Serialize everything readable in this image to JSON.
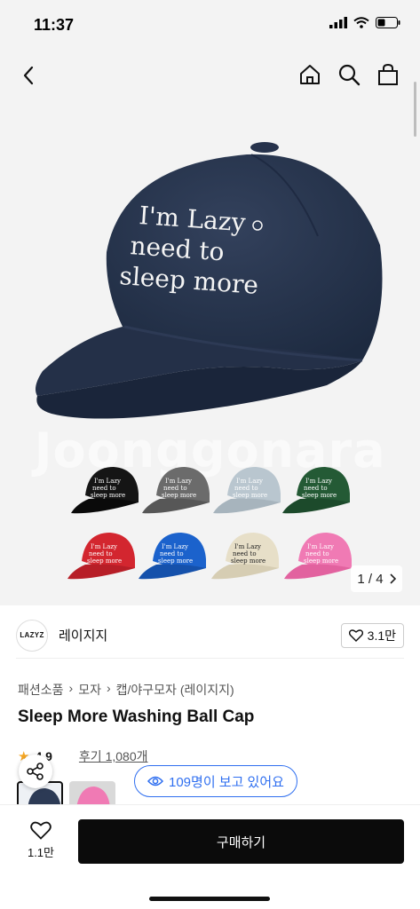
{
  "status_bar": {
    "time": "11:37"
  },
  "hero": {
    "cap_text_lines": [
      "I'm Lazy",
      "need to",
      "sleep more"
    ],
    "watermark": "Joonggonara",
    "counter": {
      "current": "1",
      "separator": "/",
      "total": "4"
    },
    "colors": {
      "navy": "#2c3a55",
      "black": "#151515",
      "gray": "#6b6b6b",
      "light_blue": "#b9c6cf",
      "green": "#245a35",
      "red": "#d3262f",
      "blue": "#1b62cc",
      "beige": "#e7dfc8",
      "pink": "#f07ab4"
    }
  },
  "seller": {
    "logo": "LAZYZ",
    "name": "레이지지",
    "likes": "3.1만"
  },
  "breadcrumb": [
    "패션소품",
    "모자",
    "캡/야구모자 (레이지지)"
  ],
  "product": {
    "title": "Sleep More Washing Ball Cap",
    "rating": "4.9",
    "review_text": "후기 1,080개"
  },
  "viewers": {
    "text": "109명이 보고 있어요"
  },
  "bottom_bar": {
    "wish_count": "1.1만",
    "buy_label": "구매하기"
  }
}
